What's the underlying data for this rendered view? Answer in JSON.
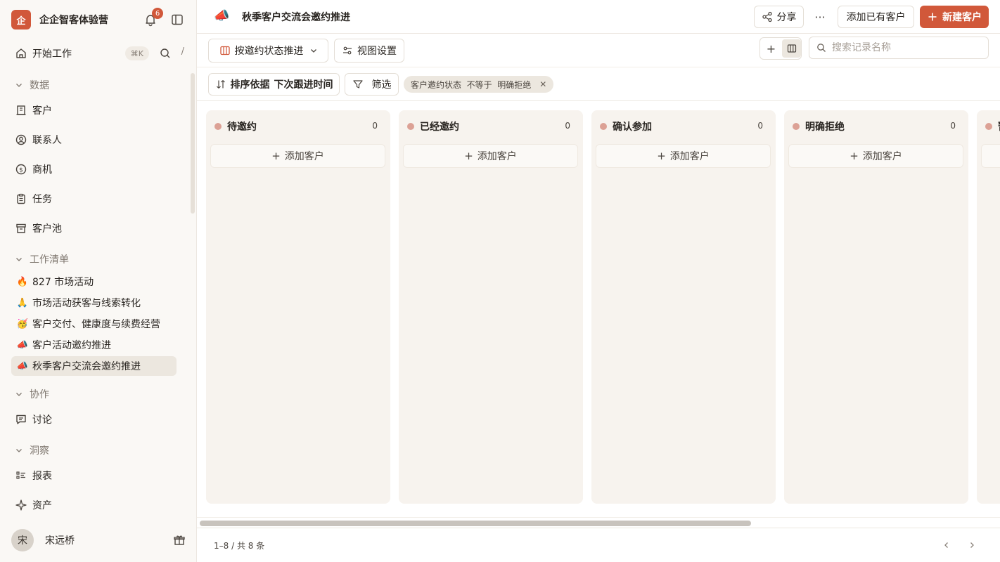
{
  "workspace": {
    "logo_char": "企",
    "name": "企企智客体验营",
    "notification_count": "6"
  },
  "nav": {
    "start": {
      "label": "开始工作",
      "shortcut": "⌘K",
      "slash": "/"
    }
  },
  "sections": {
    "data": {
      "title": "数据",
      "items": [
        {
          "label": "客户",
          "icon": "building-icon"
        },
        {
          "label": "联系人",
          "icon": "contact-icon"
        },
        {
          "label": "商机",
          "icon": "dollar-icon"
        },
        {
          "label": "任务",
          "icon": "clipboard-icon"
        },
        {
          "label": "客户池",
          "icon": "archive-icon"
        }
      ]
    },
    "worklist": {
      "title": "工作清单",
      "items": [
        {
          "emoji": "🔥",
          "label": "827 市场活动"
        },
        {
          "emoji": "🙏",
          "label": "市场活动获客与线索转化"
        },
        {
          "emoji": "🥳",
          "label": "客户交付、健康度与续费经营"
        },
        {
          "emoji": "📣",
          "label": "客户活动邀约推进"
        },
        {
          "emoji": "📣",
          "label": "秋季客户交流会邀约推进"
        }
      ]
    },
    "collab": {
      "title": "协作",
      "items": [
        {
          "label": "讨论",
          "icon": "chat-icon"
        }
      ]
    },
    "insight": {
      "title": "洞察",
      "items": [
        {
          "label": "报表",
          "icon": "report-icon"
        },
        {
          "label": "资产",
          "icon": "sparkle-icon"
        }
      ]
    }
  },
  "user": {
    "avatar_char": "宋",
    "name": "宋远桥"
  },
  "header": {
    "page_emoji": "📣",
    "title": "秋季客户交流会邀约推进",
    "share_label": "分享",
    "more_label": "···",
    "add_existing_label": "添加已有客户",
    "new_label": "新建客户"
  },
  "toolbar": {
    "group_by_label": "按邀约状态推进",
    "view_settings_label": "视图设置",
    "add_label": "+",
    "search_placeholder": "搜索记录名称",
    "sort_label": "排序依据",
    "sort_field": "下次跟进时间",
    "filter_label": "筛选",
    "filter_chip": "客户邀约状态  不等于  明确拒绝"
  },
  "board": {
    "add_card_label": "添加客户",
    "columns": [
      {
        "name": "待邀约",
        "count": "0",
        "color": "#dca195"
      },
      {
        "name": "已经邀约",
        "count": "0",
        "color": "#dca195"
      },
      {
        "name": "确认参加",
        "count": "0",
        "color": "#dca195"
      },
      {
        "name": "明确拒绝",
        "count": "0",
        "color": "#dca195"
      },
      {
        "name": "暂",
        "count": "",
        "color": "#dca195"
      }
    ]
  },
  "footer": {
    "pager_text": "1–8 / 共 8 条"
  }
}
